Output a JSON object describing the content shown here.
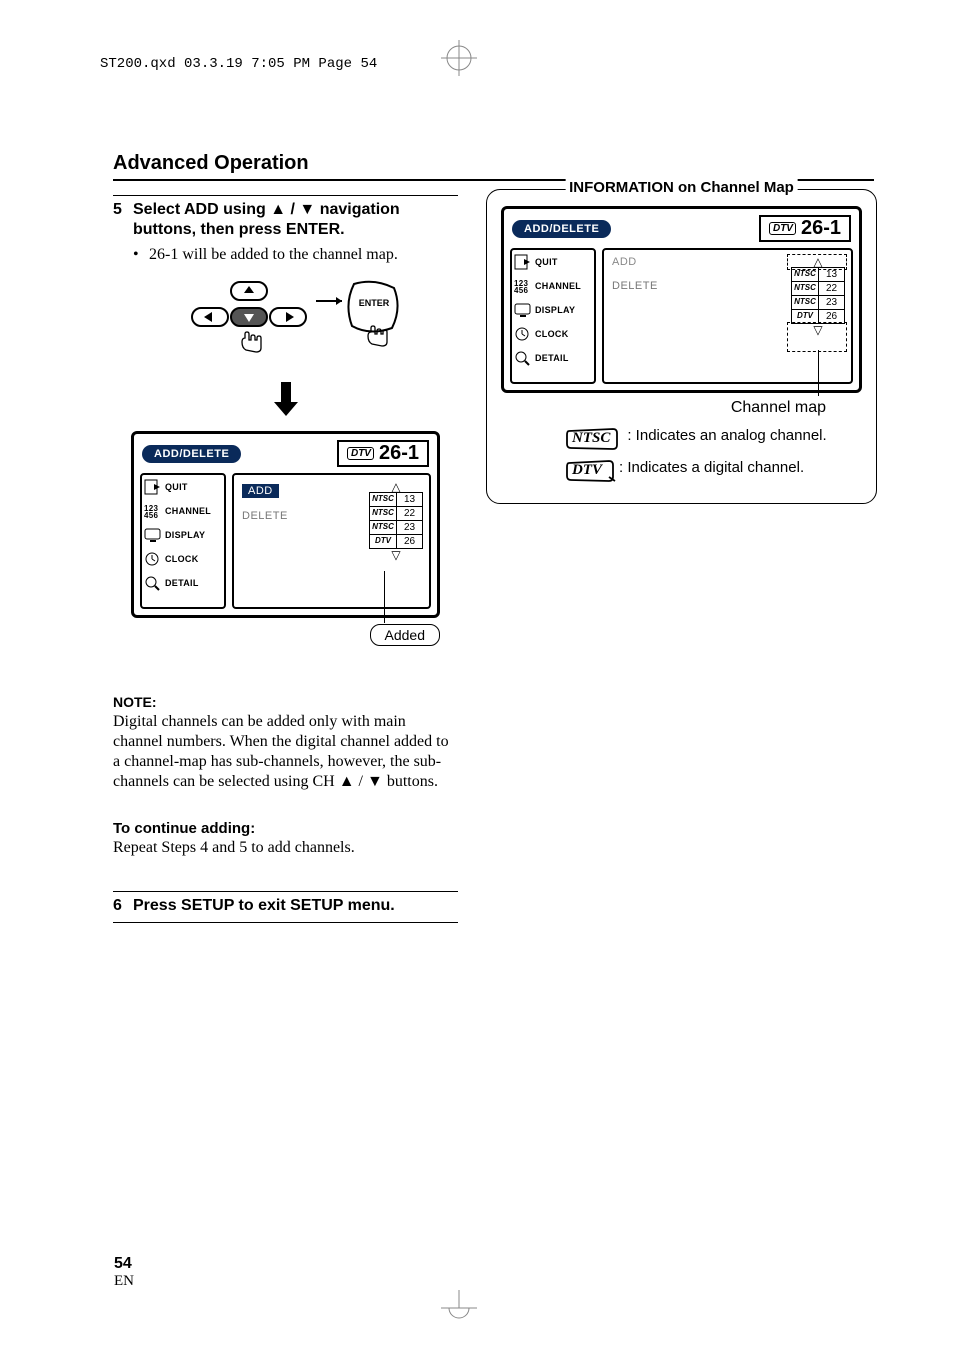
{
  "header_line": "ST200.qxd  03.3.19 7:05 PM  Page 54",
  "section_title": "Advanced Operation",
  "step5": {
    "num": "5",
    "text_before_arrows": "Select ADD using ",
    "text_between": " / ",
    "text_after": " navigation buttons, then press ENTER.",
    "bullet": "26-1 will be added to the channel map."
  },
  "remote": {
    "enter_label": "ENTER"
  },
  "osd": {
    "title": "ADD/DELETE",
    "dtv_tag": "DTV",
    "channel": "26-1",
    "left_menu": [
      "QUIT",
      "CHANNEL",
      "DISPLAY",
      "CLOCK",
      "DETAIL"
    ],
    "options": [
      "ADD",
      "DELETE"
    ],
    "ch_list": [
      {
        "tag": "NTSC",
        "num": "13"
      },
      {
        "tag": "NTSC",
        "num": "22"
      },
      {
        "tag": "NTSC",
        "num": "23"
      },
      {
        "tag": "DTV",
        "num": "26"
      }
    ],
    "added_label": "Added"
  },
  "note": {
    "head": "NOTE:",
    "body_part1": "Digital channels can be added only with main channel numbers. When the digital channel added to a channel-map has sub-channels, however, the sub-channels can be selected using CH ",
    "body_between": " / ",
    "body_part2": " buttons."
  },
  "continue": {
    "head": "To continue adding:",
    "body": "Repeat Steps 4 and 5  to add channels."
  },
  "step6": {
    "num": "6",
    "text": "Press SETUP to exit SETUP menu."
  },
  "info": {
    "title": "INFORMATION on Channel Map",
    "chmap_label": "Channel map",
    "ntsc_label": "NTSC",
    "ntsc_desc": ": Indicates an analog channel.",
    "dtv_label": "DTV",
    "dtv_desc": ": Indicates a digital channel."
  },
  "page_num": "54",
  "page_lang": "EN"
}
